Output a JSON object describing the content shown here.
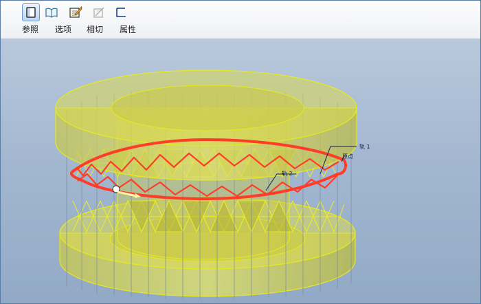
{
  "toolbar": {
    "tabs": [
      {
        "label": "参照",
        "icon": "reference-icon",
        "active": true
      },
      {
        "label": "选项",
        "icon": "options-icon",
        "active": false
      },
      {
        "label": "相切",
        "icon": "tangency-icon",
        "active": false
      },
      {
        "label": "属性",
        "icon": "properties-icon",
        "active": false
      }
    ],
    "extra_icon": "sketch-icon"
  },
  "viewport": {
    "annotations": {
      "label_1": "轨 1",
      "label_2": "轨 2",
      "label_origin": "原点"
    },
    "colors": {
      "model_fill": "#d8d850",
      "model_edge": "#e6ea1c",
      "trajectory": "#ff3c28",
      "hidden_edge": "#7d8ea0"
    }
  }
}
